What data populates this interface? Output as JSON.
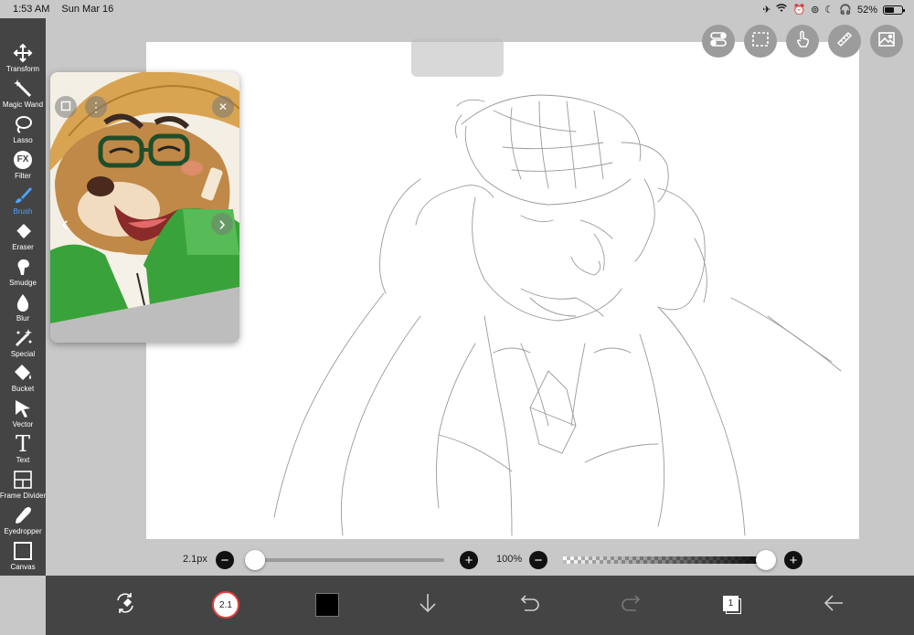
{
  "status": {
    "time": "1:53 AM",
    "date": "Sun Mar 16",
    "battery": "52%"
  },
  "toolbar": {
    "items": [
      {
        "label": "Transform",
        "icon": "transform-icon"
      },
      {
        "label": "Magic Wand",
        "icon": "magic-wand-icon"
      },
      {
        "label": "Lasso",
        "icon": "lasso-icon"
      },
      {
        "label": "Filter",
        "icon": "fx-icon"
      },
      {
        "label": "Brush",
        "icon": "brush-icon",
        "active": true
      },
      {
        "label": "Eraser",
        "icon": "eraser-icon"
      },
      {
        "label": "Smudge",
        "icon": "smudge-icon"
      },
      {
        "label": "Blur",
        "icon": "blur-drop-icon"
      },
      {
        "label": "Special",
        "icon": "special-icon"
      },
      {
        "label": "Bucket",
        "icon": "bucket-icon"
      },
      {
        "label": "Vector",
        "icon": "vector-arrow-icon"
      },
      {
        "label": "Text",
        "icon": "text-icon"
      },
      {
        "label": "Frame Divider",
        "icon": "frame-divider-icon"
      },
      {
        "label": "Eyedropper",
        "icon": "eyedropper-icon"
      },
      {
        "label": "Canvas",
        "icon": "canvas-icon"
      }
    ],
    "fx_glyph": "FX",
    "text_glyph": "T",
    "active_color": "#4aa3ff"
  },
  "reference": {
    "prev": "‹",
    "next": "›",
    "menu": "⋮",
    "close": "✕"
  },
  "sliders": {
    "brush_size_label": "2.1px",
    "brush_size_fraction": 0.0,
    "opacity_label": "100%",
    "opacity_fraction": 1.0,
    "minus": "−",
    "plus": "+"
  },
  "bottom_bar": {
    "brush_size_badge": "2.1",
    "current_color": "#000000",
    "layers_count": "1"
  }
}
